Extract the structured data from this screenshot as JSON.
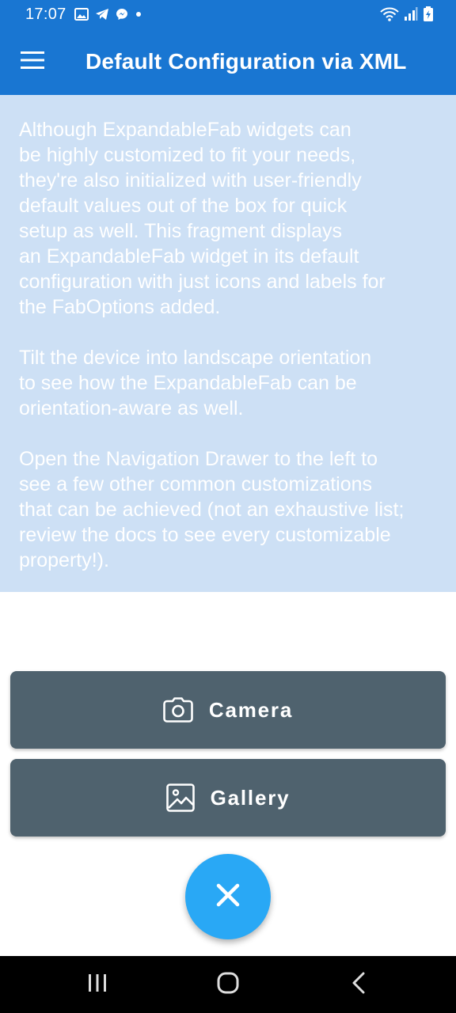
{
  "status_bar": {
    "time": "17:07",
    "left_icons": [
      "gallery-icon",
      "telegram-icon",
      "messenger-icon",
      "dot-icon"
    ],
    "right_icons": [
      "wifi-icon",
      "signal-icon",
      "battery-icon"
    ]
  },
  "app_bar": {
    "title": "Default Configuration via XML",
    "menu_icon": "hamburger-menu-icon",
    "color": "#1976d2"
  },
  "info": {
    "paragraphs": [
      "Although ExpandableFab widgets can\nbe highly customized to fit your needs,\nthey're also initialized with user-friendly\ndefault values out of the box for quick\nsetup as well. This fragment displays\nan ExpandableFab widget in its default\nconfiguration with just icons and labels for\nthe FabOptions added.",
      "Tilt the device into landscape orientation\nto see how the ExpandableFab can be\norientation-aware as well.",
      "Open the Navigation Drawer to the left to\nsee a few other common customizations\nthat can be achieved (not an exhaustive list;\nreview the docs to see every customizable\nproperty!)."
    ],
    "background": "#cde0f5"
  },
  "fab_options": [
    {
      "label": "Camera",
      "icon": "camera-icon"
    },
    {
      "label": "Gallery",
      "icon": "image-icon"
    }
  ],
  "fab_main": {
    "icon": "close-icon",
    "color": "#29a8f5"
  },
  "nav_bar": {
    "buttons": [
      "recent-apps-icon",
      "home-icon",
      "back-icon"
    ]
  }
}
